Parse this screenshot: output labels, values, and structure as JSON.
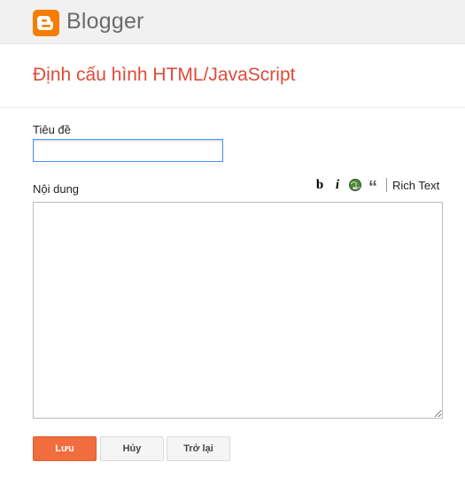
{
  "header": {
    "brand": "Blogger",
    "brand_color": "#f57d00"
  },
  "page": {
    "title": "Định cấu hình HTML/JavaScript",
    "title_color": "#dd4b39"
  },
  "form": {
    "title_label": "Tiêu đề",
    "title_value": "",
    "content_label": "Nội dung",
    "content_value": ""
  },
  "toolbar": {
    "bold_label": "b",
    "italic_label": "i",
    "link_icon": "link-globe-icon",
    "quote_label": "“",
    "rich_text_label": "Rich Text"
  },
  "actions": {
    "save_label": "Lưu",
    "cancel_label": "Hủy",
    "back_label": "Trở lại",
    "save_color": "#f26d3d"
  }
}
